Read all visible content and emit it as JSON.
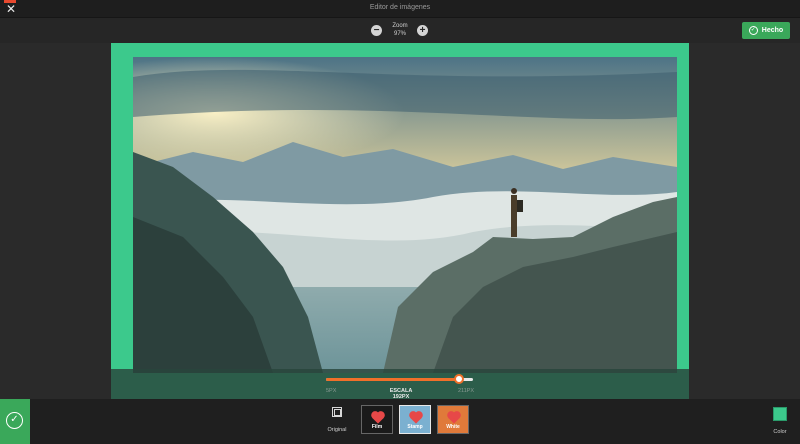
{
  "window": {
    "title": "Editor de imágenes",
    "close_glyph": "✕"
  },
  "toolbar": {
    "zoom_minus": "−",
    "zoom_plus": "+",
    "zoom_label": "Zoom",
    "zoom_value": "97%",
    "done_label": "Hecho",
    "done_icon": "check-circle-icon"
  },
  "canvas": {
    "frame_color": "#3cc98c"
  },
  "slider": {
    "min_label": "5PX",
    "max_label": "211PX",
    "value_label": "ESCALA 192PX",
    "value": 192,
    "min": 5,
    "max": 211,
    "fill_color": "#f0702a"
  },
  "bottom": {
    "apply_icon": "check-circle-icon",
    "original_label": "Original",
    "frames": [
      {
        "name": "film",
        "caption": "Film",
        "selected": false,
        "bg": "#1a1a1a"
      },
      {
        "name": "stamp",
        "caption": "Stamp",
        "selected": true,
        "bg": "#7bb0d0"
      },
      {
        "name": "white",
        "caption": "White",
        "selected": false,
        "bg": "#e07a3a"
      }
    ],
    "color_label": "Color",
    "color_value": "#3cc98c"
  }
}
